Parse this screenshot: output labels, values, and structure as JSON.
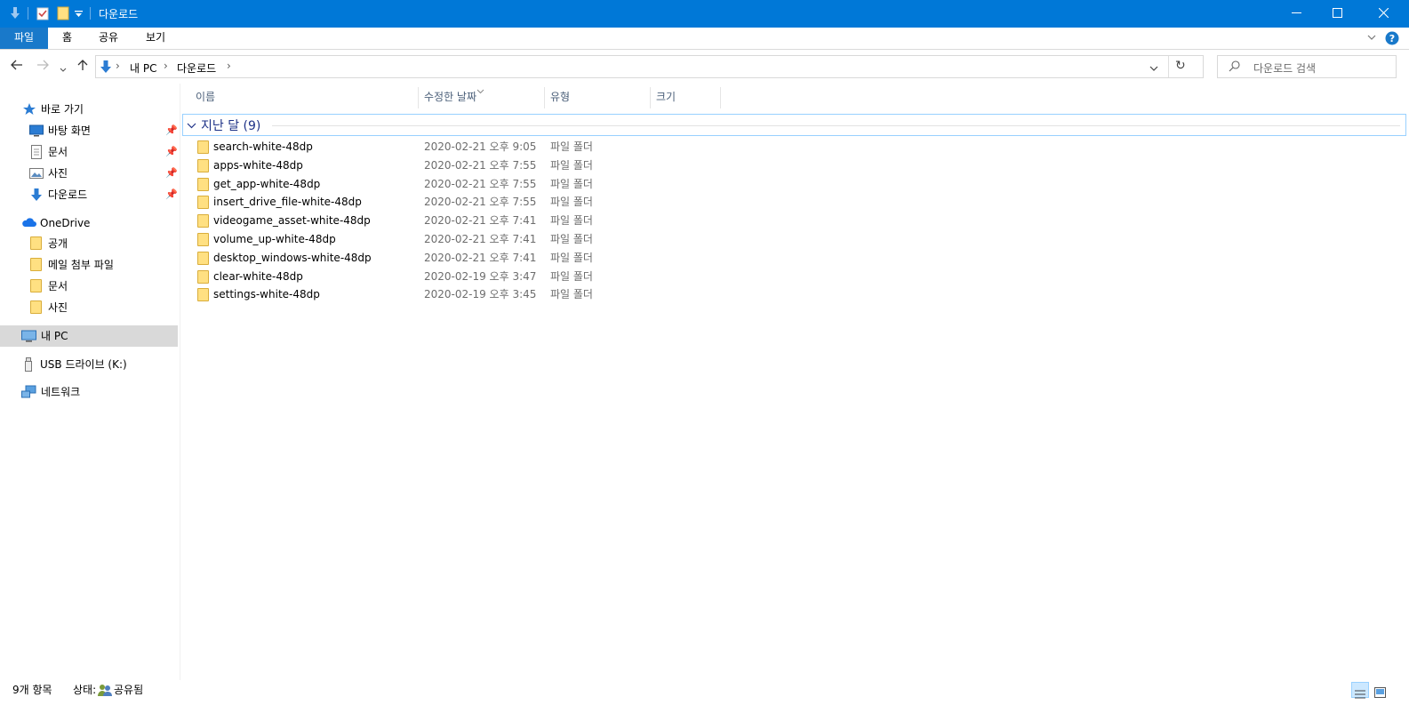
{
  "window": {
    "title": "다운로드"
  },
  "ribbon": {
    "tabs": [
      "파일",
      "홈",
      "공유",
      "보기"
    ]
  },
  "address": {
    "path": [
      "내 PC",
      "다운로드"
    ],
    "refresh_icon": "refresh-icon"
  },
  "search": {
    "placeholder": "다운로드 검색"
  },
  "sidebar": {
    "quick_access": "바로 가기",
    "quick_items": [
      "바탕 화면",
      "문서",
      "사진",
      "다운로드"
    ],
    "onedrive": "OneDrive",
    "onedrive_items": [
      "공개",
      "메일 첨부 파일",
      "문서",
      "사진"
    ],
    "this_pc": "내 PC",
    "usb": "USB 드라이브 (K:)",
    "network": "네트워크"
  },
  "columns": {
    "name": "이름",
    "date": "수정한 날짜",
    "type": "유형",
    "size": "크기"
  },
  "group": {
    "label": "지난 달 (9)"
  },
  "files": [
    {
      "name": "search-white-48dp",
      "date": "2020-02-21 오후 9:05",
      "type": "파일 폴더"
    },
    {
      "name": "apps-white-48dp",
      "date": "2020-02-21 오후 7:55",
      "type": "파일 폴더"
    },
    {
      "name": "get_app-white-48dp",
      "date": "2020-02-21 오후 7:55",
      "type": "파일 폴더"
    },
    {
      "name": "insert_drive_file-white-48dp",
      "date": "2020-02-21 오후 7:55",
      "type": "파일 폴더"
    },
    {
      "name": "videogame_asset-white-48dp",
      "date": "2020-02-21 오후 7:41",
      "type": "파일 폴더"
    },
    {
      "name": "volume_up-white-48dp",
      "date": "2020-02-21 오후 7:41",
      "type": "파일 폴더"
    },
    {
      "name": "desktop_windows-white-48dp",
      "date": "2020-02-21 오후 7:41",
      "type": "파일 폴더"
    },
    {
      "name": "clear-white-48dp",
      "date": "2020-02-19 오후 3:47",
      "type": "파일 폴더"
    },
    {
      "name": "settings-white-48dp",
      "date": "2020-02-19 오후 3:45",
      "type": "파일 폴더"
    }
  ],
  "status": {
    "count": "9개 항목",
    "state_label": "상태:",
    "state_value": "공유됨"
  },
  "colors": {
    "titlebar": "#0078d7",
    "file_tab": "#1979ca",
    "selected": "#d9d9d9",
    "group_text": "#1e3287"
  }
}
